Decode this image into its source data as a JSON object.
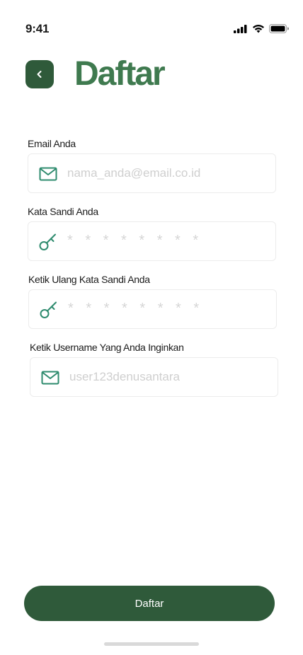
{
  "status_bar": {
    "time": "9:41",
    "icons": [
      "signal-icon",
      "wifi-icon",
      "battery-icon"
    ]
  },
  "header": {
    "back_icon": "chevron-left-icon",
    "title": "Daftar"
  },
  "form": {
    "fields": [
      {
        "label": "Email Anda",
        "placeholder": "nama_anda@email.co.id",
        "icon": "mail-icon"
      },
      {
        "label": "Kata Sandi Anda",
        "placeholder": "* * * * * * * *",
        "icon": "key-icon"
      },
      {
        "label": "Ketik Ulang Kata Sandi Anda",
        "placeholder": "* * * * * * * *",
        "icon": "key-icon"
      },
      {
        "label": "Ketik Username Yang Anda Inginkan",
        "placeholder": "user123denusantara",
        "icon": "mail-icon"
      }
    ],
    "submit_label": "Daftar"
  },
  "colors": {
    "primary": "#2f5a3a",
    "title": "#3f7a4f",
    "icon": "#2e8b6e",
    "placeholder": "#cfcfcf"
  }
}
